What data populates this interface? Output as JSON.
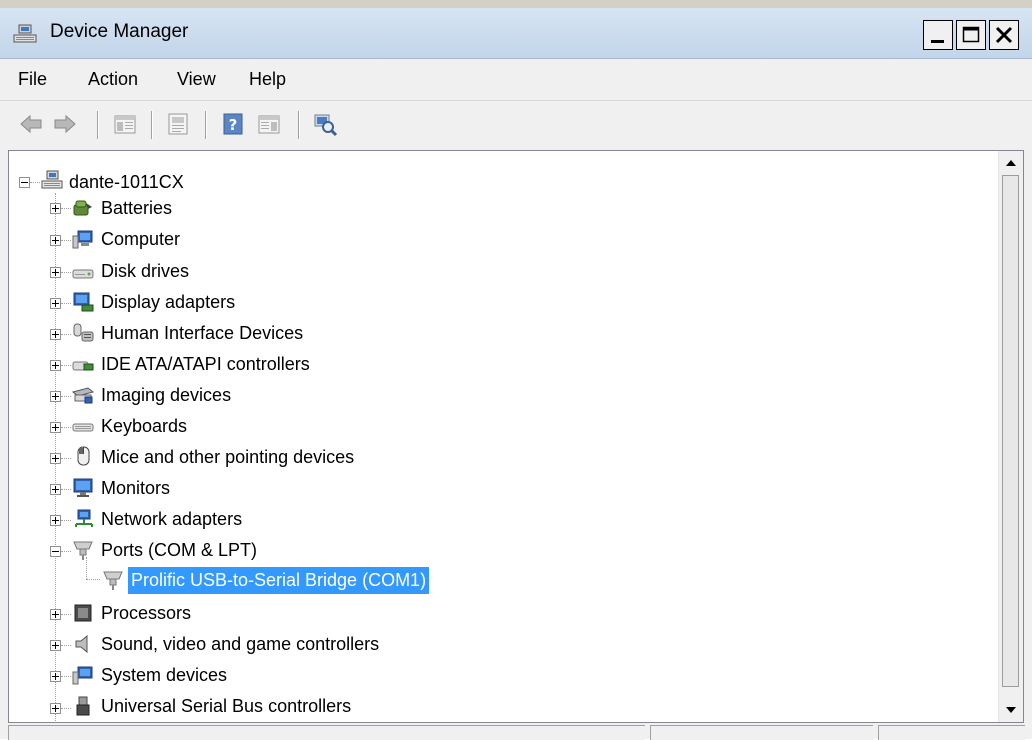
{
  "window": {
    "title": "Device Manager",
    "accent": "#3399ff"
  },
  "menu": {
    "file": "File",
    "action": "Action",
    "view": "View",
    "help": "Help"
  },
  "toolbar": {
    "buttons": [
      "back-arrow-icon",
      "forward-arrow-icon",
      "show-hide-console-tree-icon",
      "properties-icon",
      "help-icon",
      "action-pane-icon",
      "scan-hardware-icon"
    ]
  },
  "tree": {
    "root": {
      "label": "dante-1011CX",
      "icon": "computer-root-icon"
    },
    "items": [
      {
        "label": "Batteries",
        "icon": "battery-icon",
        "expanded": false
      },
      {
        "label": "Computer",
        "icon": "computer-icon",
        "expanded": false
      },
      {
        "label": "Disk drives",
        "icon": "disk-drive-icon",
        "expanded": false
      },
      {
        "label": "Display adapters",
        "icon": "display-adapter-icon",
        "expanded": false
      },
      {
        "label": "Human Interface Devices",
        "icon": "hid-icon",
        "expanded": false
      },
      {
        "label": "IDE ATA/ATAPI controllers",
        "icon": "ide-controller-icon",
        "expanded": false
      },
      {
        "label": "Imaging devices",
        "icon": "scanner-icon",
        "expanded": false
      },
      {
        "label": "Keyboards",
        "icon": "keyboard-icon",
        "expanded": false
      },
      {
        "label": "Mice and other pointing devices",
        "icon": "mouse-icon",
        "expanded": false
      },
      {
        "label": "Monitors",
        "icon": "monitor-icon",
        "expanded": false
      },
      {
        "label": "Network adapters",
        "icon": "network-adapter-icon",
        "expanded": false
      },
      {
        "label": "Ports (COM & LPT)",
        "icon": "port-icon",
        "expanded": true
      },
      {
        "label": "Processors",
        "icon": "processor-icon",
        "expanded": false
      },
      {
        "label": "Sound, video and game controllers",
        "icon": "speaker-icon",
        "expanded": false
      },
      {
        "label": "System devices",
        "icon": "system-devices-icon",
        "expanded": false
      },
      {
        "label": "Universal Serial Bus controllers",
        "icon": "usb-icon",
        "expanded": false
      }
    ],
    "selected_child": {
      "label": "Prolific USB-to-Serial Bridge (COM1)",
      "icon": "port-icon"
    }
  }
}
